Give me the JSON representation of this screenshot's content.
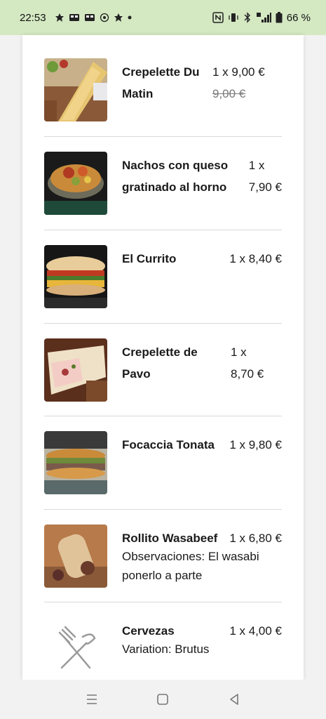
{
  "status_bar": {
    "time": "22:53",
    "battery_percent": "66 %"
  },
  "order_items": [
    {
      "name_line1": "Crepelette Du",
      "name_line2": "Matin",
      "price": "1 x 9,00 €",
      "old_price": "9,00 €"
    },
    {
      "name_line1": "Nachos con queso",
      "name_line2": "gratinado al horno",
      "price_line1": "1 x",
      "price_line2": "7,90 €"
    },
    {
      "name_line1": "El Currito",
      "price": "1 x 8,40 €"
    },
    {
      "name_line1": "Crepelette de",
      "name_line2": "Pavo",
      "price_line1": "1 x",
      "price_line2": "8,70 €"
    },
    {
      "name_line1": "Focaccia Tonata",
      "price": "1 x 9,80 €"
    },
    {
      "name_line1": "Rollito Wasabeef",
      "price": "1 x 6,80 €",
      "note_line1": "Observaciones: El wasabi",
      "note_line2": "ponerlo a parte"
    },
    {
      "name_line1": "Cervezas",
      "price": "1 x 4,00 €",
      "note_line1": "Variation: Brutus"
    }
  ],
  "icons": {
    "placeholder": "fork-knife-icon",
    "nav_recent": "recent-apps-icon",
    "nav_home": "home-icon",
    "nav_back": "back-icon"
  },
  "colors": {
    "status_bar_bg": "#d4e8c2",
    "card_bg": "#ffffff",
    "separator": "#d9d9d9"
  }
}
